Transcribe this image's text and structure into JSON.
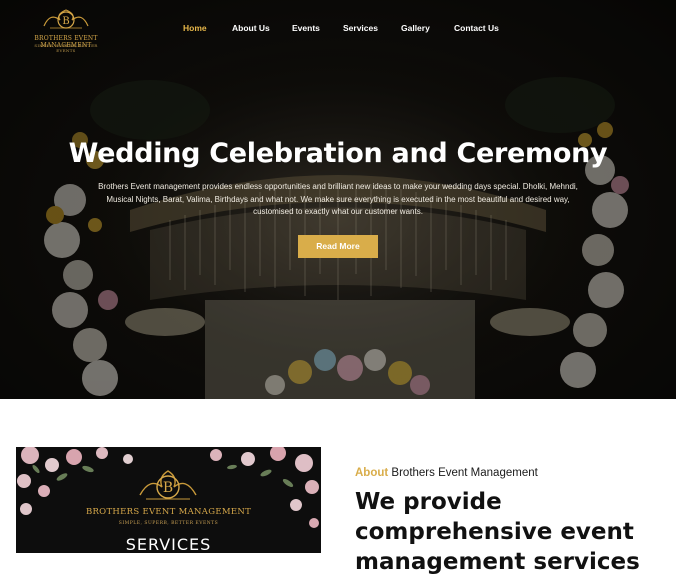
{
  "brand": {
    "name": "Brothers Event Management",
    "logo_line1": "BROTHERS EVENT MANAGEMENT",
    "logo_line2": "SIMPLE, SUPERB, BETTER EVENTS",
    "accent_color": "#d9ad4a"
  },
  "nav": {
    "items": [
      {
        "label": "Home",
        "active": true
      },
      {
        "label": "About Us",
        "active": false
      },
      {
        "label": "Events",
        "active": false
      },
      {
        "label": "Services",
        "active": false
      },
      {
        "label": "Gallery",
        "active": false
      },
      {
        "label": "Contact Us",
        "active": false
      }
    ]
  },
  "hero": {
    "title": "Wedding Celebration and Ceremony",
    "text": "Brothers Event management provides endless opportunities and brilliant new ideas to make your wedding days special. Dholki, Mehndi, Musical Nights, Barat, Valima, Birthdays and what not. We make sure everything is executed in the most beautiful and desired way, customised to exactly what our customer wants.",
    "button_label": "Read More"
  },
  "about": {
    "image_logo_line1": "BROTHERS EVENT MANAGEMENT",
    "image_logo_line2": "SIMPLE, SUPERB, BETTER EVENTS",
    "image_caption": "SERVICES",
    "kicker_accent": "About",
    "kicker_rest": "Brothers Event Management",
    "heading": "We provide comprehensive event management services"
  }
}
